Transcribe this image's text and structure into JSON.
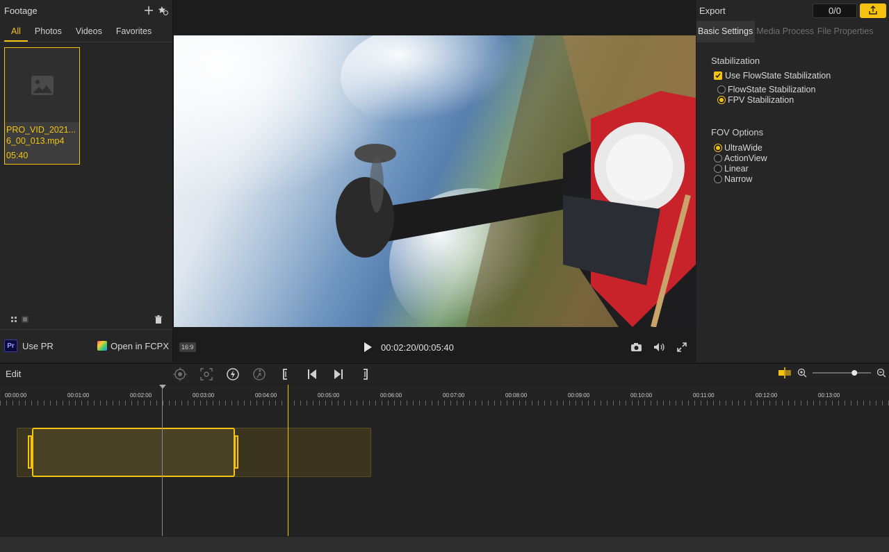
{
  "footage": {
    "title": "Footage",
    "tabs": [
      "All",
      "Photos",
      "Videos",
      "Favorites"
    ],
    "active_tab": "All",
    "clip": {
      "name": "PRO_VID_2021...6_00_013.mp4",
      "duration": "05:40"
    },
    "use_pr": "Use PR",
    "pr_badge": "Pr",
    "open_fcpx": "Open in FCPX"
  },
  "player": {
    "aspect_ratio": "16:9",
    "time": "00:02:20/00:05:40"
  },
  "export": {
    "title": "Export",
    "count": "0/0",
    "tabs": [
      "Basic Settings",
      "Media Process",
      "File Properties"
    ],
    "active_tab": "Basic Settings",
    "stabilization": {
      "title": "Stabilization",
      "use_flowstate": "Use FlowState Stabilization",
      "use_flowstate_checked": true,
      "options": [
        "FlowState Stabilization",
        "FPV Stabilization"
      ],
      "selected": "FPV Stabilization"
    },
    "fov": {
      "title": "FOV Options",
      "options": [
        "UltraWide",
        "ActionView",
        "Linear",
        "Narrow"
      ],
      "selected": "UltraWide"
    }
  },
  "edit": {
    "title": "Edit",
    "ruler": [
      "00:00:00",
      "00:01:00",
      "00:02:00",
      "00:03:00",
      "00:04:00",
      "00:05:00",
      "00:06:00",
      "00:07:00",
      "00:08:00",
      "00:09:00",
      "00:10:00",
      "00:11:00",
      "00:12:00",
      "00:13:00"
    ],
    "zoom_level": 0.74
  },
  "colors": {
    "accent": "#f5c30f",
    "bg": "#1e1e1e",
    "panel": "#262626"
  }
}
